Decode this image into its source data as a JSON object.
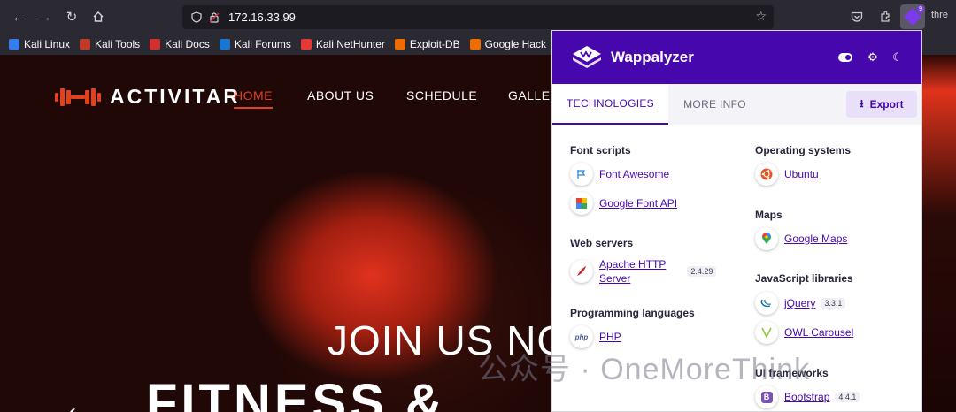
{
  "browser": {
    "url": "172.16.33.99",
    "extension_badge": "9",
    "overflow_text": "thre",
    "bookmarks": [
      {
        "label": "Kali Linux",
        "color": "#367bf0"
      },
      {
        "label": "Kali Tools",
        "color": "#c0392b"
      },
      {
        "label": "Kali Docs",
        "color": "#d32f2f"
      },
      {
        "label": "Kali Forums",
        "color": "#1976d2"
      },
      {
        "label": "Kali NetHunter",
        "color": "#e53935"
      },
      {
        "label": "Exploit-DB",
        "color": "#ef6c00"
      },
      {
        "label": "Google Hack",
        "color": "#ef6c00"
      }
    ]
  },
  "site": {
    "brand": "ACTIVITAR",
    "nav": [
      "HOME",
      "ABOUT US",
      "SCHEDULE",
      "GALLER"
    ],
    "hero_line1": "JOIN US NO",
    "hero_line2": "FITNESS & ",
    "accent_color": "#e2411e"
  },
  "wappalyzer": {
    "title": "Wappalyzer",
    "tabs": [
      "TECHNOLOGIES",
      "MORE INFO"
    ],
    "export_label": "Export",
    "left_column": [
      {
        "category": "Font scripts",
        "items": [
          {
            "name": "Font Awesome",
            "icon": "font-awesome-flag-icon"
          },
          {
            "name": "Google Font API",
            "icon": "google-font-icon"
          }
        ]
      },
      {
        "category": "Web servers",
        "items": [
          {
            "name": "Apache HTTP Server",
            "name_line1": "Apache HTTP",
            "name_line2": "Server",
            "version": "2.4.29",
            "icon": "apache-feather-icon"
          }
        ]
      },
      {
        "category": "Programming languages",
        "items": [
          {
            "name": "PHP",
            "icon": "php-icon"
          }
        ]
      }
    ],
    "right_column": [
      {
        "category": "Operating systems",
        "items": [
          {
            "name": "Ubuntu",
            "icon": "ubuntu-icon"
          }
        ]
      },
      {
        "category": "Maps",
        "items": [
          {
            "name": "Google Maps",
            "icon": "google-maps-pin-icon"
          }
        ]
      },
      {
        "category": "JavaScript libraries",
        "items": [
          {
            "name": "jQuery",
            "version": "3.3.1",
            "icon": "jquery-icon"
          },
          {
            "name": "OWL Carousel",
            "icon": "owl-carousel-icon"
          }
        ]
      },
      {
        "category": "UI frameworks",
        "items": [
          {
            "name": "Bootstrap",
            "version": "4.4.1",
            "icon": "bootstrap-icon"
          }
        ]
      }
    ]
  },
  "watermark": "公众号 · OneMoreThink"
}
